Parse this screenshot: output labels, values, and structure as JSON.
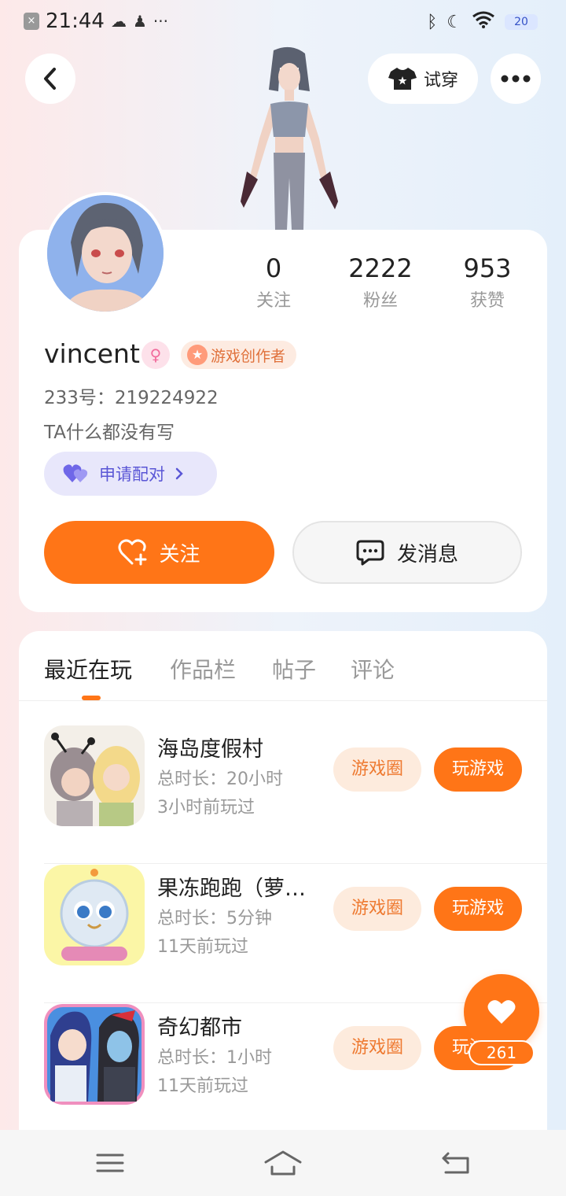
{
  "status_bar": {
    "time": "21:44",
    "battery": "20",
    "icons": [
      "sim-off-icon",
      "cloud-icon",
      "qq-icon",
      "more-dots-icon",
      "bluetooth-icon",
      "moon-icon",
      "wifi-icon",
      "battery-icon"
    ]
  },
  "header": {
    "tryon_label": "试穿"
  },
  "profile": {
    "username": "vincent",
    "badge_label": "游戏创作者",
    "uid_label": "233号：219224922",
    "bio": "TA什么都没有写",
    "pair_label": "申请配对",
    "follow_label": "关注",
    "message_label": "发消息",
    "stats": [
      {
        "value": "0",
        "label": "关注"
      },
      {
        "value": "2222",
        "label": "粉丝"
      },
      {
        "value": "953",
        "label": "获赞"
      }
    ]
  },
  "tabs": [
    {
      "label": "最近在玩",
      "active": true
    },
    {
      "label": "作品栏",
      "active": false
    },
    {
      "label": "帖子",
      "active": false
    },
    {
      "label": "评论",
      "active": false
    }
  ],
  "games": [
    {
      "name": "海岛度假村",
      "duration": "总时长：20小时",
      "last_played": "3小时前玩过",
      "circle_label": "游戏圈",
      "play_label": "玩游戏"
    },
    {
      "name": "果冻跑跑（萝…",
      "duration": "总时长：5分钟",
      "last_played": "11天前玩过",
      "circle_label": "游戏圈",
      "play_label": "玩游戏"
    },
    {
      "name": "奇幻都市",
      "duration": "总时长：1小时",
      "last_played": "11天前玩过",
      "circle_label": "游戏圈",
      "play_label": "玩游戏"
    }
  ],
  "like_count": "261",
  "colors": {
    "accent": "#ff7517",
    "pair_purple": "#5a56d6",
    "badge_orange": "#e0713b"
  }
}
